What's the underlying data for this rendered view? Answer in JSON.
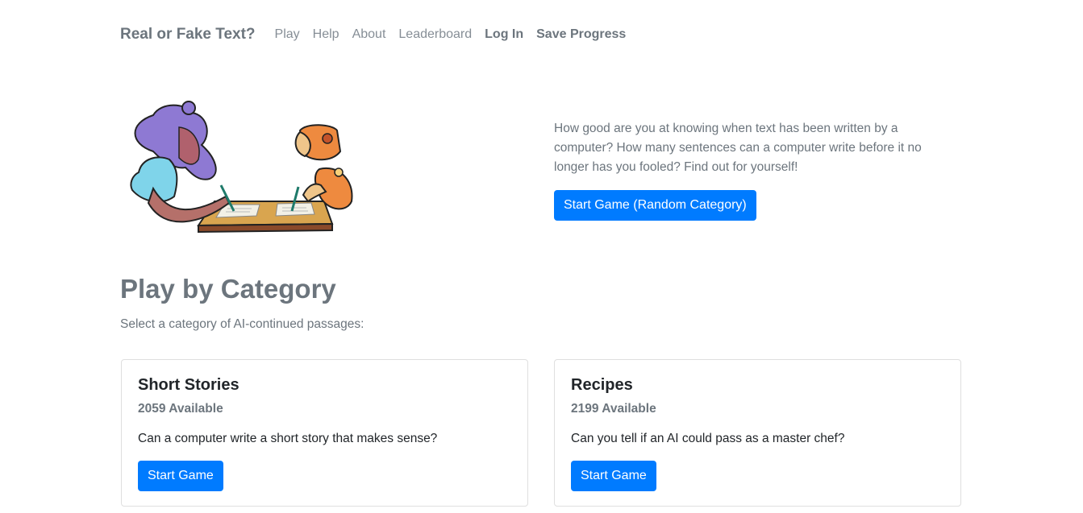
{
  "nav": {
    "brand": "Real or Fake Text?",
    "links": [
      "Play",
      "Help",
      "About",
      "Leaderboard"
    ],
    "login": "Log In",
    "save_progress": "Save Progress"
  },
  "hero": {
    "illustration_icon": "person-and-robot-writing-illustration",
    "description": "How good are you at knowing when text has been written by a computer? How many sentences can a computer write before it no longer has you fooled? Find out for yourself!",
    "button_label": "Start Game (Random Category)"
  },
  "section": {
    "title": "Play by Category",
    "subtitle": "Select a category of AI-continued passages:"
  },
  "categories": [
    {
      "title": "Short Stories",
      "available": "2059 Available",
      "description": "Can a computer write a short story that makes sense?",
      "button_label": "Start Game"
    },
    {
      "title": "Recipes",
      "available": "2199 Available",
      "description": "Can you tell if an AI could pass as a master chef?",
      "button_label": "Start Game"
    }
  ],
  "colors": {
    "primary": "#007bff",
    "muted": "#6c757d",
    "text": "#212529"
  }
}
